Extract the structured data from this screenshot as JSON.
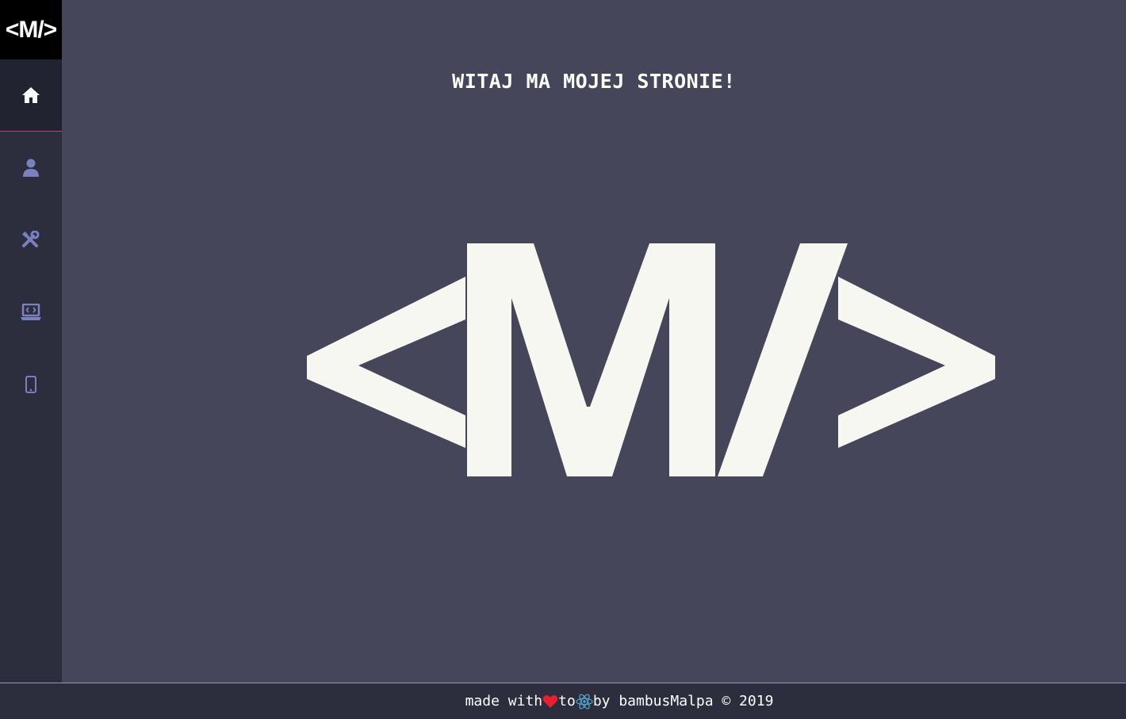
{
  "brand": {
    "logo_text": "<M/>"
  },
  "sidebar": {
    "items": [
      {
        "icon": "home-icon",
        "active": true
      },
      {
        "icon": "user-icon",
        "active": false
      },
      {
        "icon": "tools-icon",
        "active": false
      },
      {
        "icon": "laptop-code-icon",
        "active": false
      },
      {
        "icon": "mobile-icon",
        "active": false
      }
    ]
  },
  "main": {
    "welcome": "WITAJ MA MOJEJ STRONIE!",
    "logo_text": "<M/>"
  },
  "footer": {
    "made_with": "made with",
    "to": "to",
    "by": "by bambusMalpa © 2019",
    "heart_icon": "heart-icon",
    "react_icon": "react-icon"
  },
  "colors": {
    "background": "#454659",
    "sidebar": "#2c2d3d",
    "active_border": "#b5467e",
    "icon": "#7a80c0",
    "logo": "#f7f7f2",
    "heart": "#e81f2c",
    "react": "#4fa3c7"
  }
}
